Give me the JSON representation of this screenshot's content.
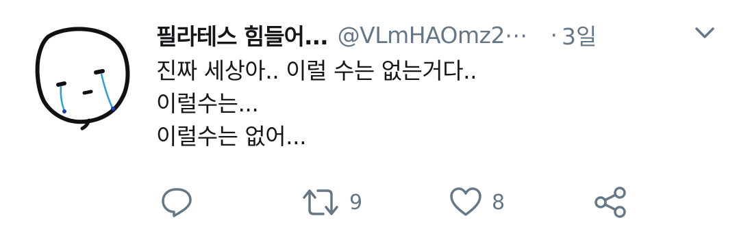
{
  "tweet": {
    "display_name": "필라테스 힘들어...",
    "handle": "@VLmHAOmz2⋯",
    "separator": "·",
    "time": "3일",
    "body_lines": [
      "진짜 세상아.. 이럴 수는 없는거다..",
      "이럴수는...",
      "이럴수는 없어..."
    ]
  },
  "actions": {
    "reply_icon": "reply-icon",
    "retweet_icon": "retweet-icon",
    "retweet_count": "9",
    "like_icon": "heart-icon",
    "like_count": "8",
    "share_icon": "share-icon"
  },
  "colors": {
    "text": "#14171a",
    "muted": "#657786",
    "icon": "#657786"
  }
}
